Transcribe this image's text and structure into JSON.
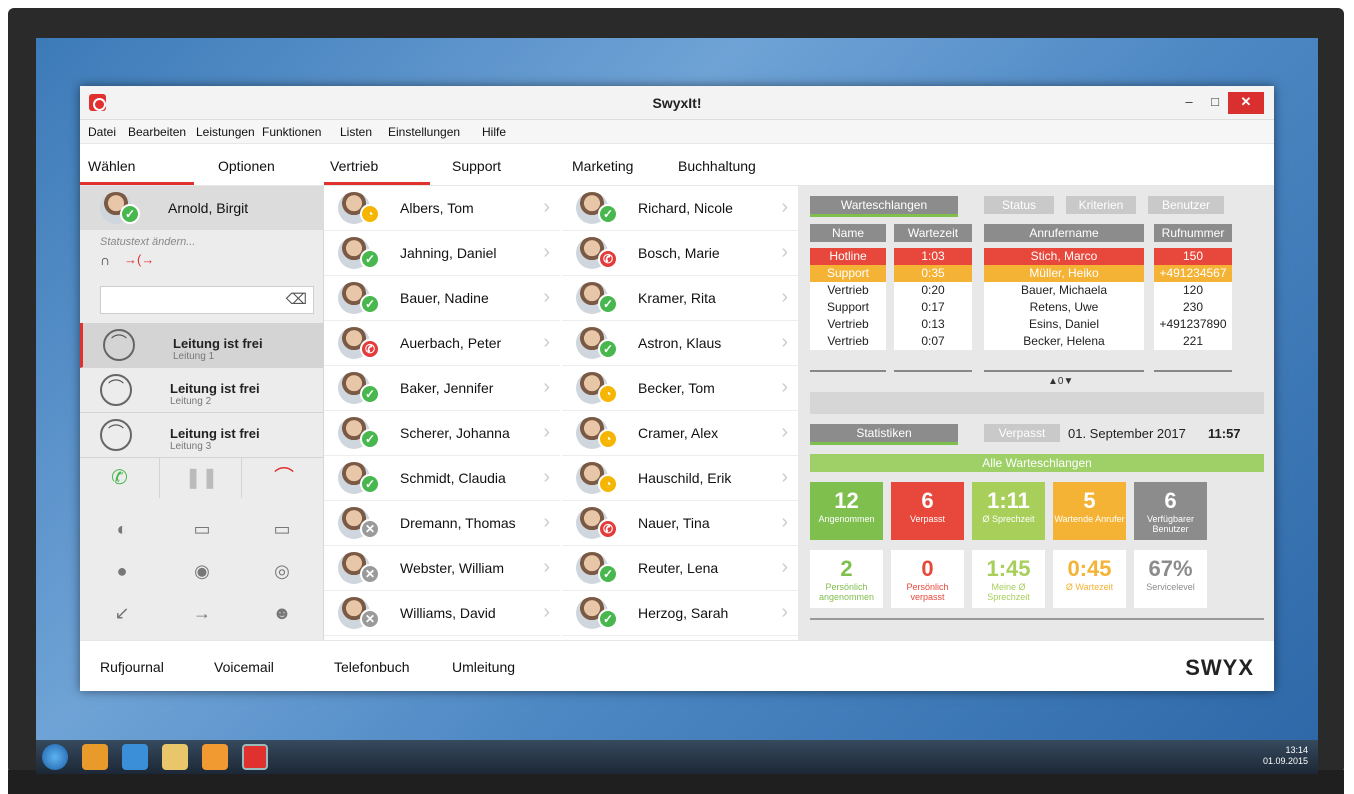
{
  "window": {
    "title": "SwyxIt!",
    "minimize": "–",
    "maximize": "□",
    "close": "✕"
  },
  "menu": [
    "Datei",
    "Bearbeiten",
    "Leistungen",
    "Funktionen",
    "Listen",
    "Einstellungen",
    "Hilfe"
  ],
  "tabs": [
    "Wählen",
    "Optionen",
    "Vertrieb",
    "Support",
    "Marketing",
    "Buchhaltung"
  ],
  "self": {
    "name": "Arnold, Birgit",
    "status_placeholder": "Statustext ändern..."
  },
  "lines": [
    {
      "title": "Leitung ist frei",
      "sub": "Leitung 1"
    },
    {
      "title": "Leitung ist frei",
      "sub": "Leitung 2"
    },
    {
      "title": "Leitung ist frei",
      "sub": "Leitung 3"
    }
  ],
  "contacts_col1": [
    {
      "name": "Albers, Tom",
      "status": "away"
    },
    {
      "name": "Jahning, Daniel",
      "status": "ok"
    },
    {
      "name": "Bauer, Nadine",
      "status": "ok"
    },
    {
      "name": "Auerbach, Peter",
      "status": "busy"
    },
    {
      "name": "Baker, Jennifer",
      "status": "ok"
    },
    {
      "name": "Scherer, Johanna",
      "status": "ok"
    },
    {
      "name": "Schmidt, Claudia",
      "status": "ok"
    },
    {
      "name": "Dremann, Thomas",
      "status": "off"
    },
    {
      "name": "Webster, William",
      "status": "off"
    },
    {
      "name": "Williams, David",
      "status": "off"
    }
  ],
  "contacts_col2": [
    {
      "name": "Richard, Nicole",
      "status": "ok"
    },
    {
      "name": "Bosch, Marie",
      "status": "busy"
    },
    {
      "name": "Kramer, Rita",
      "status": "ok"
    },
    {
      "name": "Astron, Klaus",
      "status": "ok"
    },
    {
      "name": "Becker, Tom",
      "status": "away"
    },
    {
      "name": "Cramer, Alex",
      "status": "away"
    },
    {
      "name": "Hauschild, Erik",
      "status": "away"
    },
    {
      "name": "Nauer, Tina",
      "status": "busy"
    },
    {
      "name": "Reuter, Lena",
      "status": "ok"
    },
    {
      "name": "Herzog, Sarah",
      "status": "ok"
    }
  ],
  "queues": {
    "tabs": [
      "Warteschlangen",
      "Status",
      "Kriterien",
      "Benutzer"
    ],
    "headers": [
      "Name",
      "Wartezeit",
      "Anrufername",
      "Rufnummer"
    ],
    "rows": [
      [
        "Hotline",
        "1:03",
        "Stich, Marco",
        "150"
      ],
      [
        "Support",
        "0:35",
        "Müller, Heiko",
        "+491234567"
      ],
      [
        "Vertrieb",
        "0:20",
        "Bauer, Michaela",
        "120"
      ],
      [
        "Support",
        "0:17",
        "Retens, Uwe",
        "230"
      ],
      [
        "Vertrieb",
        "0:13",
        "Esins, Daniel",
        "+491237890"
      ],
      [
        "Vertrieb",
        "0:07",
        "Becker, Helena",
        "221"
      ]
    ],
    "pager": "▲0▼"
  },
  "stats": {
    "tab": "Statistiken",
    "filter": "Verpasst",
    "date": "01. September 2017",
    "time": "11:57",
    "banner": "Alle Warteschlangen",
    "tiles_top": [
      {
        "big": "12",
        "sm": "Angenommen",
        "color": "#7fbf4d"
      },
      {
        "big": "6",
        "sm": "Verpasst",
        "color": "#e8483c"
      },
      {
        "big": "1:11",
        "sm": "Ø Sprechzeit",
        "color": "#a7cf5a"
      },
      {
        "big": "5",
        "sm": "Wartende Anrufer",
        "color": "#f5b335"
      },
      {
        "big": "6",
        "sm": "Verfügbarer Benutzer",
        "color": "#8c8c8c"
      }
    ],
    "tiles_bottom": [
      {
        "big": "2",
        "sm": "Persönlich angenommen",
        "color": "#7fbf4d"
      },
      {
        "big": "0",
        "sm": "Persönlich verpasst",
        "color": "#e8483c"
      },
      {
        "big": "1:45",
        "sm": "Meine Ø Sprechzeit",
        "color": "#a7cf5a"
      },
      {
        "big": "0:45",
        "sm": "Ø Wartezeit",
        "color": "#f5b335"
      },
      {
        "big": "67%",
        "sm": "Servicelevel",
        "color": "#8c8c8c"
      }
    ]
  },
  "bottom_tabs": [
    "Rufjournal",
    "Voicemail",
    "Telefonbuch",
    "Umleitung"
  ],
  "logo": "SWYX",
  "tray": {
    "time": "13:14",
    "date": "01.09.2015"
  }
}
